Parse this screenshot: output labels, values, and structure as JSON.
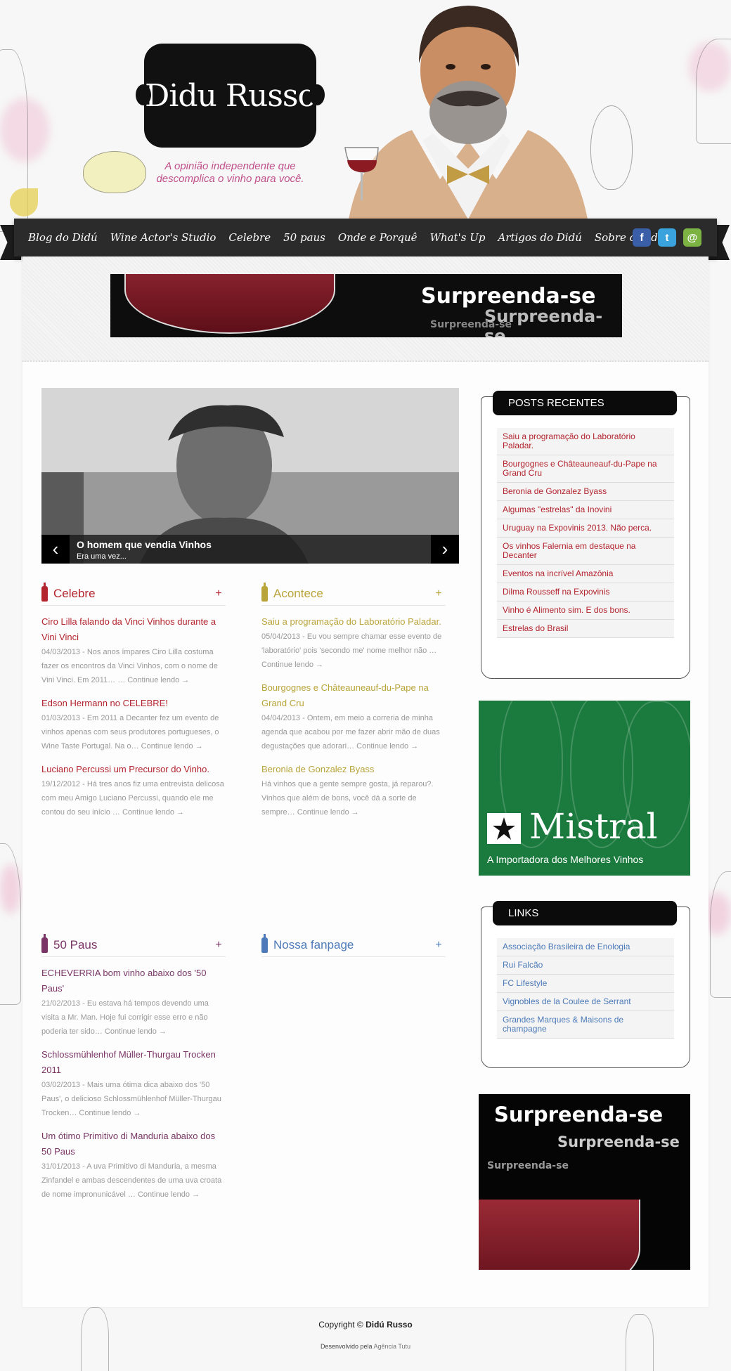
{
  "header": {
    "logo": "Didu Russo",
    "tagline": "A opinião independente que descomplica o vinho para você."
  },
  "nav": {
    "items": [
      "Blog do Didú",
      "Wine Actor's Studio",
      "Celebre",
      "50 paus",
      "Onde e Porquê",
      "What's Up",
      "Artigos do Didú",
      "Sobre o Didú"
    ],
    "social": [
      {
        "icon": "facebook-icon",
        "glyph": "f",
        "color": "#3b5ea8"
      },
      {
        "icon": "twitter-icon",
        "glyph": "t",
        "color": "#3aa3dd"
      },
      {
        "icon": "email-icon",
        "glyph": "@",
        "color": "#7cb342"
      }
    ]
  },
  "top_banner": {
    "headline": "Surpreenda-se",
    "echo1": "Surpreenda-se",
    "echo2": "Surpreenda-se"
  },
  "slider": {
    "title": "O homem que vendia Vinhos",
    "subtitle": "Era uma vez...",
    "prev_icon": "chevron-left-icon",
    "next_icon": "chevron-right-icon",
    "prev_glyph": "‹",
    "next_glyph": "›"
  },
  "sections": {
    "celebre": {
      "title": "Celebre",
      "plus": "+",
      "color": "#b3242e",
      "posts": [
        {
          "title": "Ciro Lilla falando da Vinci Vinhos durante a Vini Vinci",
          "meta": "04/03/2013 - Nos anos ímpares Ciro Lilla costuma fazer os encontros da Vinci Vinhos, com o nome de Vini Vinci. Em 2011… … Continue lendo →"
        },
        {
          "title": "Edson Hermann no CELEBRE!",
          "meta": "01/03/2013 - Em 2011 a Decanter fez um evento de vinhos apenas com seus produtores portugueses, o Wine Taste Portugal. Na o… Continue lendo →"
        },
        {
          "title": "Luciano Percussi um Precursor do Vinho.",
          "meta": "19/12/2012 - Há tres anos fiz uma entrevista delicosa com meu Amigo Luciano Percussi, quando ele me contou do seu início … Continue lendo →"
        }
      ]
    },
    "acontece": {
      "title": "Acontece",
      "plus": "+",
      "color": "#b9a43a",
      "posts": [
        {
          "title": "Saiu a programação do Laboratório Paladar.",
          "meta": "05/04/2013 - Eu vou sempre chamar esse evento de 'laboratório' pois 'secondo me' nome melhor não … Continue lendo →"
        },
        {
          "title": "Bourgognes e Châteauneauf-du-Pape na Grand Cru",
          "meta": "04/04/2013 - Ontem, em meio a correria de minha agenda que acabou por me fazer abrir mão de duas degustações que adorari… Continue lendo →"
        },
        {
          "title": "Beronia de Gonzalez Byass",
          "meta": "Há vinhos que a gente sempre gosta, já reparou?. Vinhos que além de bons, você dá a sorte de sempre… Continue lendo →"
        }
      ]
    },
    "cinquenta": {
      "title": "50 Paus",
      "plus": "+",
      "color": "#7a3566",
      "posts": [
        {
          "title": "ECHEVERRIA bom vinho abaixo dos '50 Paus'",
          "meta": "21/02/2013 - Eu estava há tempos devendo uma visita a Mr. Man. Hoje fui corrigir esse erro e não poderia ter sido… Continue lendo →"
        },
        {
          "title": "Schlossmühlenhof Müller-Thurgau Trocken 2011",
          "meta": "03/02/2013 - Mais uma ótima dica abaixo dos '50 Paus', o delicioso Schlossmühlenhof Müller-Thurgau Trocken… Continue lendo →"
        },
        {
          "title": "Um ótimo Primitivo di Manduria abaixo dos 50 Paus",
          "meta": "31/01/2013 - A uva Primitivo di Manduria, a mesma Zinfandel e ambas descendentes de uma uva croata de nome impronunicável … Continue lendo →"
        }
      ]
    },
    "fanpage": {
      "title": "Nossa fanpage",
      "plus": "+",
      "color": "#4d7ab8"
    }
  },
  "sidebar": {
    "recent": {
      "title": "POSTS RECENTES",
      "items": [
        "Saiu a programação do Laboratório Paladar.",
        "Bourgognes e Châteauneauf-du-Pape na Grand Cru",
        "Beronia de Gonzalez Byass",
        "Algumas \"estrelas\" da Inovini",
        "Uruguay na Expovinis 2013. Não perca.",
        "Os vinhos Falernia em destaque na Decanter",
        "Eventos na incrível Amazônia",
        "Dilma Rousseff na Expovinis",
        "Vinho é Alimento sim. E dos bons.",
        "Estrelas do Brasil"
      ],
      "color": "#b3242e"
    },
    "mistral": {
      "logo": "Mistral",
      "subtitle": "A Importadora dos Melhores Vinhos"
    },
    "links": {
      "title": "LINKS",
      "items": [
        "Associação Brasileira de Enologia",
        "Rui Falcão",
        "FC Lifestyle",
        "Vignobles de la Coulee de Serrant",
        "Grandes Marques & Maisons de champagne"
      ],
      "color": "#4d7ab8"
    },
    "side_banner": {
      "headline": "Surpreenda-se",
      "echo1": "Surpreenda-se",
      "echo2": "Surpreenda-se"
    }
  },
  "footer": {
    "copyright_prefix": "Copyright © ",
    "copyright_name": "Didú Russo",
    "developed_prefix": "Desenvolvido pela ",
    "developed_by": "Agência Tutu"
  }
}
